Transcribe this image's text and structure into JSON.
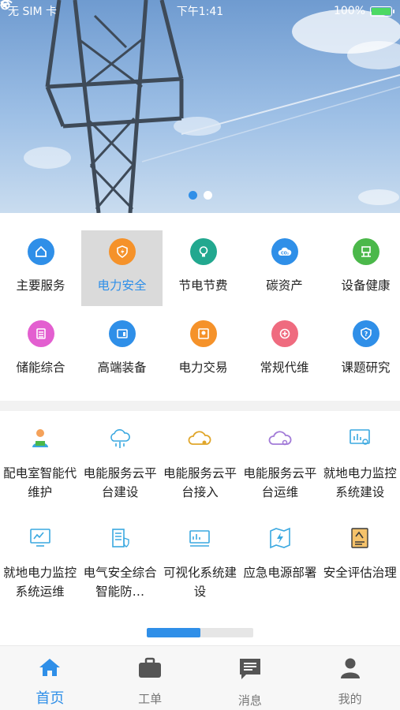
{
  "status_bar": {
    "carrier": "无 SIM 卡",
    "time": "下午1:41",
    "battery": "100%",
    "battery_level": 1.0
  },
  "banner": {
    "slide_count": 2,
    "active_slide": 0
  },
  "categories": [
    {
      "label": "主要服务",
      "icon": "home-icon",
      "color": "#2f8fe8",
      "selected": false
    },
    {
      "label": "电力安全",
      "icon": "shield-bolt-icon",
      "color": "#f5922a",
      "selected": true
    },
    {
      "label": "节电节费",
      "icon": "lightbulb-icon",
      "color": "#22a88f",
      "selected": false
    },
    {
      "label": "碳资产",
      "icon": "co2-cloud-icon",
      "color": "#2f8fe8",
      "selected": false
    },
    {
      "label": "设备健康",
      "icon": "equipment-icon",
      "color": "#4bb84a",
      "selected": false
    },
    {
      "label": "储能综合",
      "icon": "storage-icon",
      "color": "#e35fd0",
      "selected": false
    },
    {
      "label": "高端装备",
      "icon": "device-icon",
      "color": "#2f8fe8",
      "selected": false
    },
    {
      "label": "电力交易",
      "icon": "certificate-icon",
      "color": "#f5922a",
      "selected": false
    },
    {
      "label": "常规代维",
      "icon": "maintenance-icon",
      "color": "#ef6b7f",
      "selected": false
    },
    {
      "label": "课题研究",
      "icon": "question-shield-icon",
      "color": "#2f8fe8",
      "selected": false
    }
  ],
  "services": [
    {
      "label": "配电室智能代维护",
      "icon": "worker-icon"
    },
    {
      "label": "电能服务云平台建设",
      "icon": "cloud-network-icon"
    },
    {
      "label": "电能服务云平台接入",
      "icon": "cloud-link-icon"
    },
    {
      "label": "电能服务云平台运维",
      "icon": "cloud-gear-icon"
    },
    {
      "label": "就地电力监控系统建设",
      "icon": "monitor-chart-icon"
    },
    {
      "label": "就地电力监控系统运维",
      "icon": "monitor-gear-icon"
    },
    {
      "label": "电气安全综合智能防…",
      "icon": "building-shield-icon"
    },
    {
      "label": "可视化系统建设",
      "icon": "dashboard-icon"
    },
    {
      "label": "应急电源部署",
      "icon": "map-bolt-icon"
    },
    {
      "label": "安全评估治理",
      "icon": "document-check-icon"
    }
  ],
  "pager": {
    "progress": 0.5
  },
  "tabs": [
    {
      "label": "首页",
      "icon": "home-icon",
      "active": true
    },
    {
      "label": "工单",
      "icon": "briefcase-icon",
      "active": false
    },
    {
      "label": "消息",
      "icon": "message-icon",
      "active": false
    },
    {
      "label": "我的",
      "icon": "user-icon",
      "active": false
    }
  ],
  "colors": {
    "accent": "#2f8fe8",
    "selected_bg": "#dadada",
    "text": "#222222",
    "muted": "#777777"
  }
}
